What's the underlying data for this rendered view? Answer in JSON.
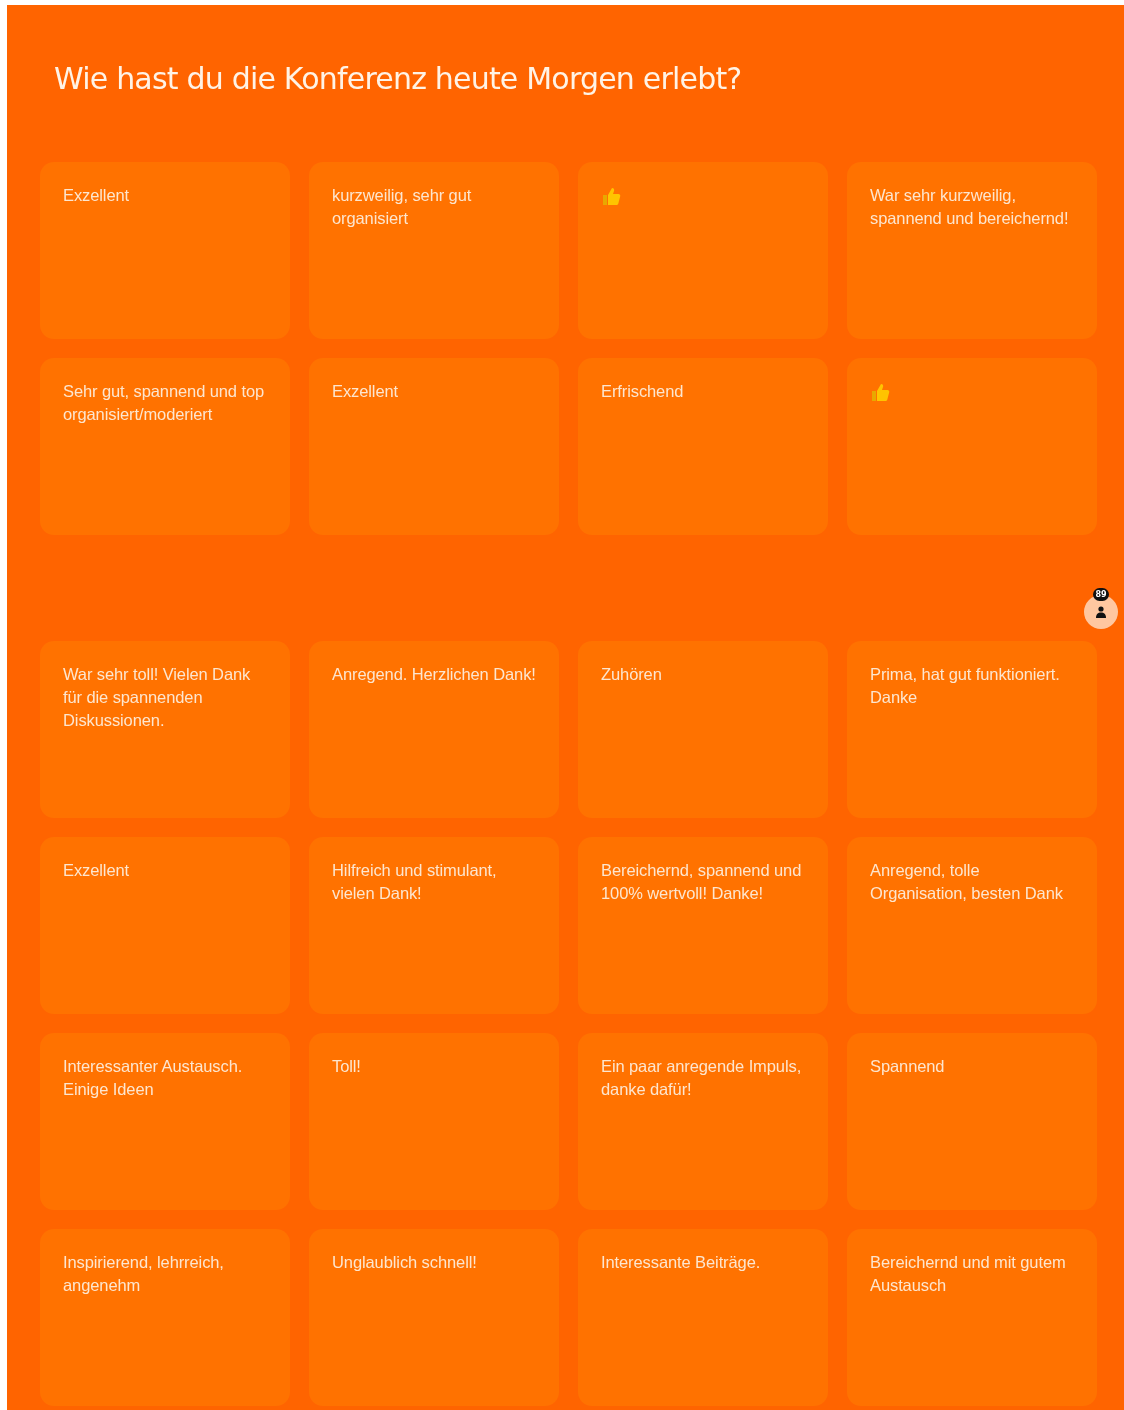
{
  "title": "Wie hast du die Konferenz heute Morgen erlebt?",
  "sections": [
    {
      "responses": [
        {
          "kind": "text",
          "text": "Exzellent"
        },
        {
          "kind": "text",
          "text": "kurzweilig, sehr gut organisiert"
        },
        {
          "kind": "thumbs_up"
        },
        {
          "kind": "text",
          "text": "War sehr kurzweilig, spannend und bereichernd!"
        },
        {
          "kind": "text",
          "text": "Sehr gut, spannend und top organisiert/moderiert"
        },
        {
          "kind": "text",
          "text": "Exzellent"
        },
        {
          "kind": "text",
          "text": "Erfrischend"
        },
        {
          "kind": "thumbs_up"
        }
      ]
    },
    {
      "responses": [
        {
          "kind": "text",
          "text": "War sehr toll! Vielen Dank für die spannenden Diskussionen."
        },
        {
          "kind": "text",
          "text": "Anregend. Herzlichen Dank!"
        },
        {
          "kind": "text",
          "text": "Zuhören"
        },
        {
          "kind": "text",
          "text": "Prima, hat gut funktioniert. Danke"
        },
        {
          "kind": "text",
          "text": "Exzellent"
        },
        {
          "kind": "text",
          "text": "Hilfreich und stimulant, vielen Dank!"
        },
        {
          "kind": "text",
          "text": "Bereichernd, spannend und 100% wertvoll! Danke!"
        },
        {
          "kind": "text",
          "text": "Anregend, tolle Organisation, besten Dank"
        },
        {
          "kind": "text",
          "text": "Interessanter Austausch. Einige Ideen"
        },
        {
          "kind": "text",
          "text": "Toll!"
        },
        {
          "kind": "text",
          "text": "Ein paar anregende Impuls, danke dafür!"
        },
        {
          "kind": "text",
          "text": "Spannend"
        },
        {
          "kind": "text",
          "text": "Inspirierend, lehrreich, angenehm"
        },
        {
          "kind": "text",
          "text": "Unglaublich schnell!"
        },
        {
          "kind": "text",
          "text": "Interessante Beiträge."
        },
        {
          "kind": "text",
          "text": "Bereichernd und mit gutem Austausch"
        }
      ]
    }
  ],
  "participants": {
    "count": "89"
  }
}
